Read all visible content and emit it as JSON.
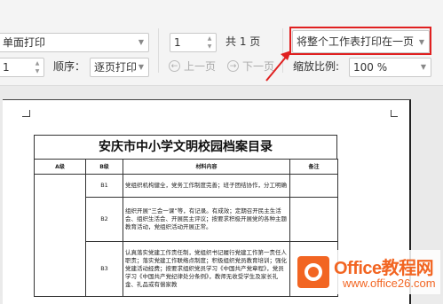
{
  "toolbar": {
    "print_mode": "单面打印",
    "copies": "1",
    "order_label": "顺序：",
    "order_value": "逐页打印",
    "page_current": "1",
    "page_total": "共 1 页",
    "prev_page": "上一页",
    "next_page": "下一页",
    "scale_option": "将整个工作表打印在一页",
    "zoom_label": "缩放比例:",
    "zoom_value": "100 %"
  },
  "document": {
    "title": "安庆市中小学文明校园档案目录",
    "headers": [
      "A级",
      "B级",
      "材料内容",
      "备注"
    ],
    "rows": [
      {
        "code": "B1",
        "content": "党组织机构健全，党务工作制度完善；班子团结协作，分工明确"
      },
      {
        "code": "B2",
        "content": "组织开展“三会一课”等，有记录。有成效；定期召开民主生活会、组织生活会、开展民主评议；按要求积极开展党的各种主题教育活动，党组织活动开展正常。"
      },
      {
        "code": "B3",
        "content": "认真落实党建工作责任制，党组织书记履行党建工作第一责任人职责；落实党建工作联络点制度；积极组织党员教育培训；强化党建活动经费；按要求组织党员学习《中国共产党章程》，党员学习《中国共产党纪律处分条例》，教师无收受学生及家长礼金、礼品或有偿家教"
      }
    ]
  },
  "watermark": {
    "brand": "Office教程网",
    "url": "www.office26.com",
    "brand_color": "#f26522"
  },
  "accent_color": "#e02020"
}
